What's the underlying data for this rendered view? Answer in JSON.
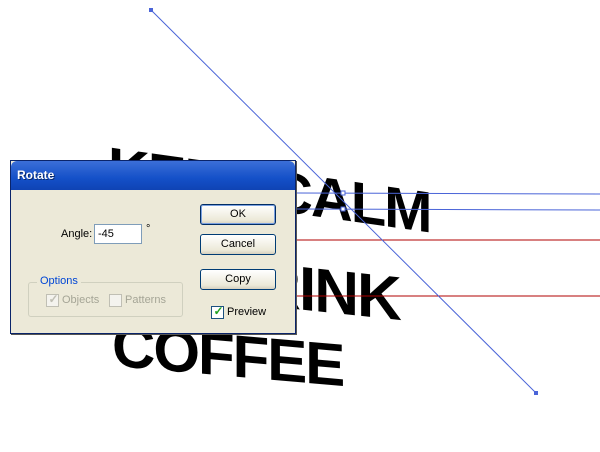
{
  "artwork": {
    "lines": [
      "KEEP CALM",
      "AND DRINK",
      "COFFEE"
    ]
  },
  "dialog": {
    "title": "Rotate",
    "angle_label": "Angle:",
    "angle_value": "-45",
    "degree_symbol": "°",
    "options_title": "Options",
    "objects_label": "Objects",
    "patterns_label": "Patterns",
    "preview_label": "Preview",
    "ok_label": "OK",
    "cancel_label": "Cancel",
    "copy_label": "Copy",
    "objects_checked": true,
    "patterns_checked": false,
    "preview_checked": true
  },
  "colors": {
    "guide_blue": "#4a64d8",
    "guide_red": "#b00000",
    "title_blue": "#1450c8"
  }
}
